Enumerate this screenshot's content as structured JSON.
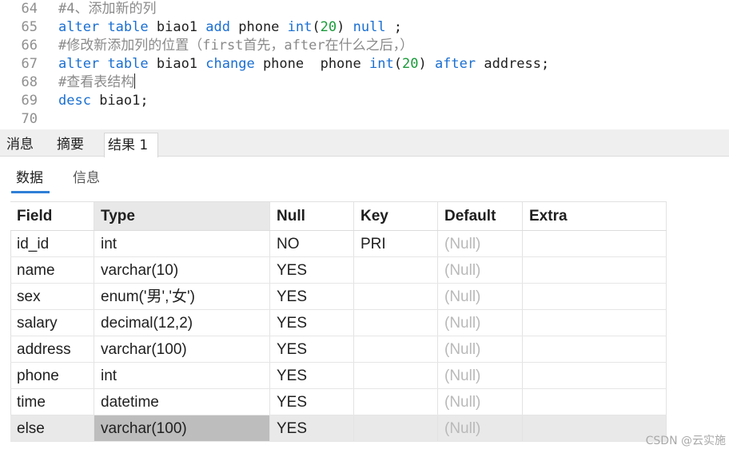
{
  "editor": {
    "lines": [
      {
        "num": "64",
        "parts": [
          {
            "t": "#4、添加新的列",
            "c": "cm"
          }
        ]
      },
      {
        "num": "65",
        "parts": [
          {
            "t": "alter",
            "c": "kw"
          },
          {
            "t": " "
          },
          {
            "t": "table",
            "c": "kw"
          },
          {
            "t": " biao1 "
          },
          {
            "t": "add",
            "c": "kw"
          },
          {
            "t": " phone "
          },
          {
            "t": "int",
            "c": "kw"
          },
          {
            "t": "("
          },
          {
            "t": "20",
            "c": "num"
          },
          {
            "t": ") "
          },
          {
            "t": "null",
            "c": "kw"
          },
          {
            "t": " ;"
          }
        ]
      },
      {
        "num": "66",
        "parts": [
          {
            "t": "#修改新添加列的位置（first首先，after在什么之后，）",
            "c": "cm"
          }
        ]
      },
      {
        "num": "67",
        "parts": [
          {
            "t": "alter",
            "c": "kw"
          },
          {
            "t": " "
          },
          {
            "t": "table",
            "c": "kw"
          },
          {
            "t": " biao1 "
          },
          {
            "t": "change",
            "c": "kw"
          },
          {
            "t": " phone  phone "
          },
          {
            "t": "int",
            "c": "kw"
          },
          {
            "t": "("
          },
          {
            "t": "20",
            "c": "num"
          },
          {
            "t": ") "
          },
          {
            "t": "after",
            "c": "kw"
          },
          {
            "t": " address;"
          }
        ]
      },
      {
        "num": "68",
        "parts": [
          {
            "t": "#查看表结构",
            "c": "cm"
          }
        ],
        "caret": true
      },
      {
        "num": "69",
        "parts": [
          {
            "t": "desc",
            "c": "kw"
          },
          {
            "t": " biao1;"
          }
        ]
      },
      {
        "num": "70",
        "parts": []
      }
    ]
  },
  "result_tabs": [
    "消息",
    "摘要",
    "结果 1"
  ],
  "active_result_tab": "结果 1",
  "sub_tabs": [
    "数据",
    "信息"
  ],
  "active_sub_tab": "数据",
  "grid": {
    "columns": [
      "Field",
      "Type",
      "Null",
      "Key",
      "Default",
      "Extra"
    ],
    "rows": [
      [
        "id_id",
        "int",
        "NO",
        "PRI",
        "(Null)",
        ""
      ],
      [
        "name",
        "varchar(10)",
        "YES",
        "",
        "(Null)",
        ""
      ],
      [
        "sex",
        "enum('男','女')",
        "YES",
        "",
        "(Null)",
        ""
      ],
      [
        "salary",
        "decimal(12,2)",
        "YES",
        "",
        "(Null)",
        ""
      ],
      [
        "address",
        "varchar(100)",
        "YES",
        "",
        "(Null)",
        ""
      ],
      [
        "phone",
        "int",
        "YES",
        "",
        "(Null)",
        ""
      ],
      [
        "time",
        "datetime",
        "YES",
        "",
        "(Null)",
        ""
      ],
      [
        "else",
        "varchar(100)",
        "YES",
        "",
        "(Null)",
        ""
      ]
    ],
    "null_text": "(Null)",
    "selected_row": 7,
    "selected_column": "Type"
  },
  "watermark": "CSDN @云实施",
  "colors": {
    "keyword": "#1a6fd1",
    "number": "#1a9a3a",
    "comment": "#8a8a8a",
    "tab_underline": "#2f7fd6"
  }
}
